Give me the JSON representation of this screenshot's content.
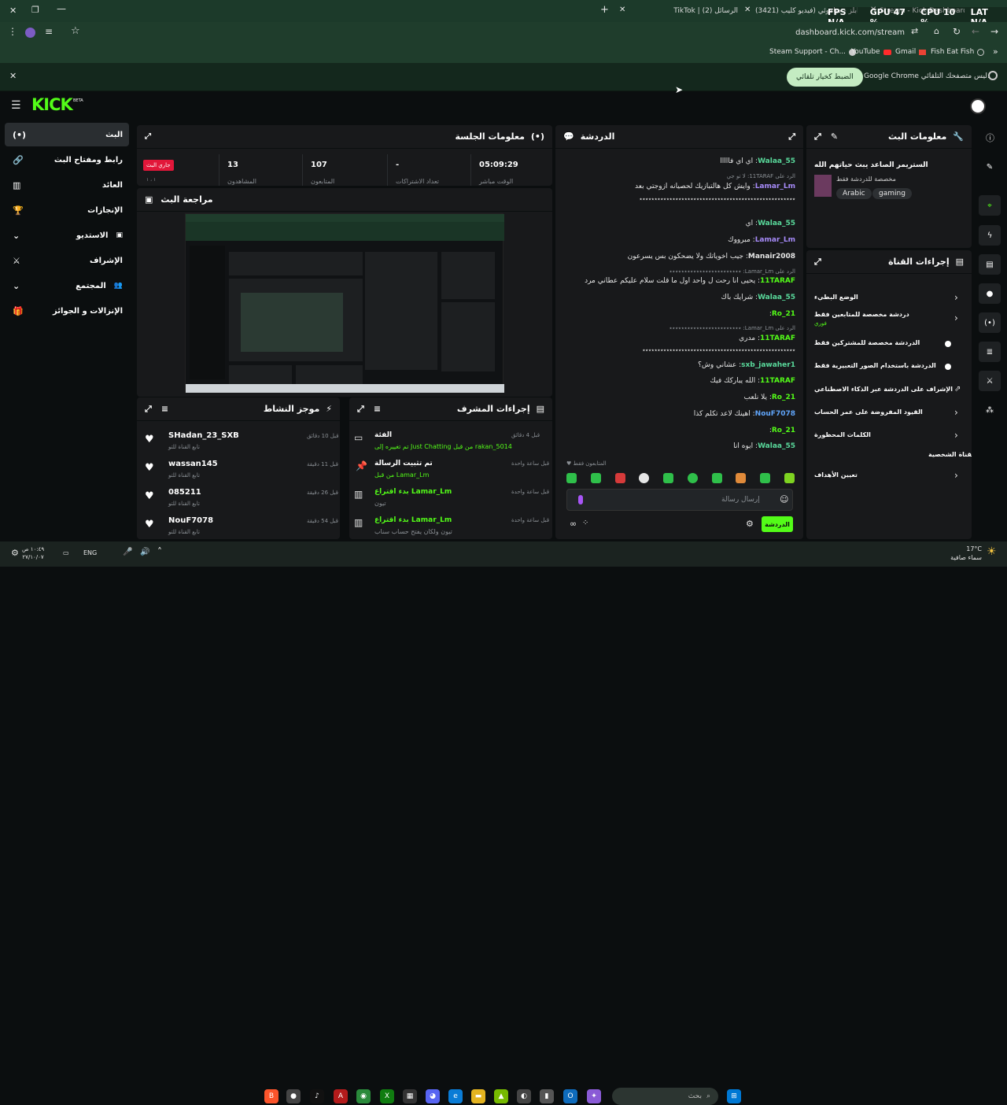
{
  "browser": {
    "tabs": [
      {
        "label": "TikTok | الرسائل (2)"
      },
      {
        "label": "(3421) دابلز - صاموئي (فيديو كليب"
      },
      {
        "label": "Stream - Kick Dashboard"
      }
    ],
    "hud": {
      "fps": "FPS",
      "fps_val": "N/A",
      "gpu": "GPU",
      "gpu_val": "47 %",
      "cpu": "CPU",
      "cpu_val": "10 %",
      "lat": "LAT",
      "lat_val": "N/A"
    },
    "url": "dashboard.kick.com/stream",
    "bookmarks": [
      "Steam Support - Ch...",
      "YouTube",
      "Gmail",
      "Fish Eat Fish"
    ],
    "infobar": {
      "text": "Google Chrome ليس متصفحك التلقائي.",
      "button": "الضبط كخيار تلقائي"
    }
  },
  "sidebar": {
    "logo": "KICK",
    "beta": "BETA",
    "items": [
      {
        "label": "البث"
      },
      {
        "label": "رابط ومفتاح البث"
      },
      {
        "label": "العائد"
      },
      {
        "label": "الإنجازات"
      },
      {
        "label": "الاستديو"
      },
      {
        "label": "الإشراف"
      },
      {
        "label": "المجتمع"
      },
      {
        "label": "الإنزالات و الجوائز"
      }
    ]
  },
  "session": {
    "title": "معلومات الجلسة",
    "live_badge": "جاري البث",
    "live_sub": "١ ، ١",
    "stats": [
      {
        "value": "05:09:29",
        "label": "الوقت مباشر"
      },
      {
        "value": "-",
        "label": "تعداد الاشتراكات"
      },
      {
        "value": "107",
        "label": "المتابعون"
      },
      {
        "value": "13",
        "label": "المشاهدون"
      }
    ]
  },
  "preview": {
    "title": "مراجعة البث"
  },
  "chat": {
    "title": "الدردشة",
    "lines": [
      {
        "user": "Walaa_55",
        "text": "اي اي فااااا",
        "color": "#59d99b"
      },
      {
        "reply": "الرد على 11TARAF: لا تو جي",
        "user": "Lamar_Lm",
        "text": "وايش كل هالتبازيك لحصيانه ازوجتي بعد",
        "color": "#a78bfa"
      },
      {
        "text": "٭٭٭٭٭٭٭٭٭٭٭٭٭٭٭٭٭٭٭٭٭٭٭٭٭٭٭٭٭٭٭٭٭٭٭٭٭٭٭٭٭٭٭٭٭٭٭٭٭٭٭٭"
      },
      {
        "user": "Walaa_55",
        "text": "اي",
        "color": "#59d99b"
      },
      {
        "user": "Lamar_Lm",
        "text": "مبرووك",
        "color": "#a78bfa"
      },
      {
        "user": "Manair2008",
        "text": "جيب اخوياتك ولا يضحكون بس يسرعون",
        "color": "#e6e6e6"
      },
      {
        "reply": "الرد على Lamar_Lm: ٭٭٭٭٭٭٭٭٭٭٭٭٭٭٭٭٭٭٭٭٭٭٭٭",
        "user": "11TARAF",
        "text": "يحيى انا رحت ل واحد اول ما قلت سلام عليكم عطاني مرد",
        "color": "#53fc18"
      },
      {
        "user": "Walaa_55",
        "text": "شرايك باك",
        "color": "#59d99b"
      },
      {
        "user": "Ro_21",
        "text": "",
        "color": "#53fc18"
      },
      {
        "reply": "الرد على Lamar_Lm: ٭٭٭٭٭٭٭٭٭٭٭٭٭٭٭٭٭٭٭٭٭٭٭٭",
        "user": "11TARAF",
        "text": "مدري",
        "color": "#53fc18"
      },
      {
        "text": "٭٭٭٭٭٭٭٭٭٭٭٭٭٭٭٭٭٭٭٭٭٭٭٭٭٭٭٭٭٭٭٭٭٭٭٭٭٭٭٭٭٭٭٭٭٭٭٭٭٭٭"
      },
      {
        "user": "sxb_jawaher1",
        "text": "عشاني وش؟",
        "color": "#59d99b"
      },
      {
        "user": "11TARAF",
        "text": "الله يباركك فيك",
        "color": "#53fc18"
      },
      {
        "user": "Ro_21",
        "text": "يلا نلعب",
        "color": "#53fc18"
      },
      {
        "user": "NouF7078",
        "text": "اهينك لاعد تكلم كذا",
        "color": "#60a5fa"
      },
      {
        "user": "Ro_21",
        "text": "",
        "color": "#53fc18"
      },
      {
        "user": "Walaa_55",
        "text": "ايوه انا",
        "color": "#59d99b"
      }
    ],
    "followers_only": "المتابعون فقط",
    "input_placeholder": "إرسال رسالة",
    "send_button": "الدردشة"
  },
  "activity": {
    "title": "موجز النشاط",
    "items": [
      {
        "user": "SHadan_23_SXB",
        "sub": "تابع القناة للتو",
        "time": "قبل 10 دقائق"
      },
      {
        "user": "wassan145",
        "sub": "تابع القناة للتو",
        "time": "قبل 11 دقيقة"
      },
      {
        "user": "085211",
        "sub": "تابع القناة للتو",
        "time": "قبل 26 دقيقة"
      },
      {
        "user": "NouF7078",
        "sub": "تابع القناة للتو",
        "time": "قبل 54 دقيقة"
      }
    ]
  },
  "modlog": {
    "title": "إجراءات المشرف",
    "items": [
      {
        "title": "الفئة",
        "line": "تم تغييره إلى Just Chatting من قبل rakan_5014",
        "time": "قبل 4 دقائق"
      },
      {
        "title": "تم تثبيت الرسالة",
        "line": "من قبل Lamar_Lm",
        "time": "قبل ساعة واحدة"
      },
      {
        "title": "بدء اقتراع Lamar_Lm",
        "line": "تيون",
        "time": "قبل ساعة واحدة"
      },
      {
        "title": "بدء اقتراع Lamar_Lm",
        "line": "تيون ولكان يفتح حساب سناب",
        "time": "قبل ساعة واحدة"
      }
    ]
  },
  "streaminfo": {
    "title": "معلومات البث",
    "stream_title": "الستريمر الصاعد يبث حياتهم الله",
    "category": "مخصصة للدردشة فقط",
    "tags": [
      "Arabic",
      "gaming"
    ]
  },
  "channel_actions": {
    "title": "إجراءات القناة",
    "items": [
      {
        "label": "الوضع البطيء",
        "sub": "",
        "type": "chevron"
      },
      {
        "label": "دردشة مخصصة للمتابعين فقط",
        "sub": "فوري",
        "type": "chevron"
      },
      {
        "label": "الدردشة مخصصة للمشتركين فقط",
        "sub": "",
        "type": "toggle"
      },
      {
        "label": "الدردشة باستخدام الصور التعبيرية فقط",
        "sub": "",
        "type": "toggle"
      },
      {
        "label": "الإشراف على الدردشة عبر الذكاء الاصطناعي",
        "sub": "",
        "type": "external"
      },
      {
        "label": "القيود المفروضة على عمر الحساب",
        "sub": "",
        "type": "chevron"
      },
      {
        "label": "الكلمات المحظورة",
        "sub": "",
        "type": "chevron"
      }
    ],
    "section": "القناة الشخصية",
    "goals": "تعيين الأهداف"
  },
  "taskbar": {
    "time": "١٠:٤٩ ص",
    "date": "٢٧/١٠/٠٧",
    "lang": "ENG",
    "search": "بحث",
    "weather_temp": "17°C",
    "weather_text": "سماء صافية"
  },
  "colors": {
    "accent": "#53fc18",
    "panel": "#18191b",
    "bg": "#0b0e0f"
  }
}
